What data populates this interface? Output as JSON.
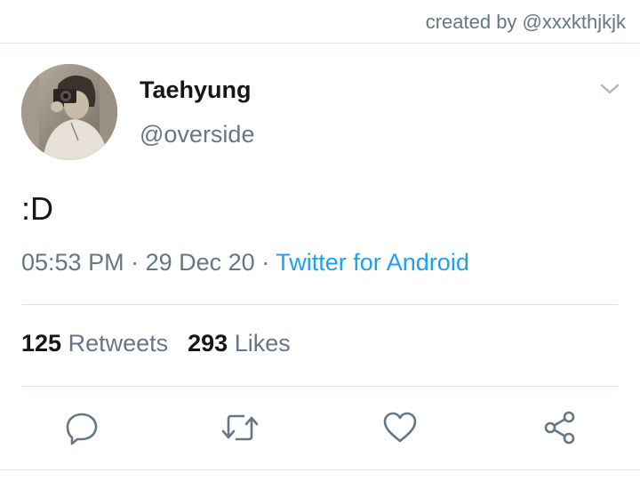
{
  "credit": "created by @xxxkthjkjk",
  "tweet": {
    "author": {
      "display_name": "Taehyung",
      "handle": "@overside",
      "avatar": "profile-photo"
    },
    "text": ":D",
    "time": "05:53 PM",
    "separator": "·",
    "date": "29 Dec 20",
    "source": "Twitter for Android"
  },
  "stats": {
    "retweets_count": "125",
    "retweets_label": "Retweets",
    "likes_count": "293",
    "likes_label": "Likes"
  },
  "actions": [
    {
      "name": "reply",
      "icon": "reply-icon"
    },
    {
      "name": "retweet",
      "icon": "retweet-icon"
    },
    {
      "name": "like",
      "icon": "heart-icon"
    },
    {
      "name": "share",
      "icon": "share-icon"
    }
  ],
  "colors": {
    "text": "#14171a",
    "secondary": "#657786",
    "link": "#1da1f2",
    "divider": "#dde3e8"
  }
}
